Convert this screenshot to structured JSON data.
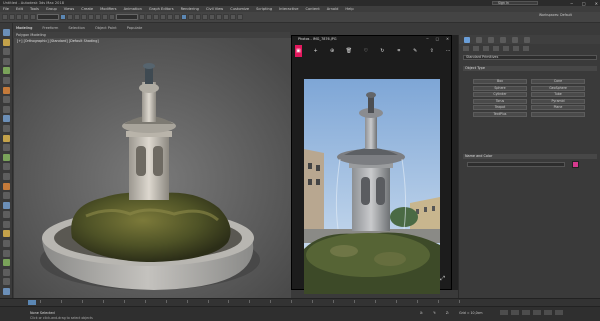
{
  "app": {
    "title": "Untitled - Autodesk 3ds Max 2018",
    "signin": "Sign In",
    "workspace": "Workspaces: Default",
    "window_controls": [
      "─",
      "□",
      "✕"
    ]
  },
  "menu": [
    "File",
    "Edit",
    "Tools",
    "Group",
    "Views",
    "Create",
    "Modifiers",
    "Animation",
    "Graph Editors",
    "Rendering",
    "Civil View",
    "Customize",
    "Scripting",
    "Interactive",
    "Content",
    "Arnold",
    "Help"
  ],
  "ribbon": {
    "tabs": [
      "Modeling",
      "Freeform",
      "Selection",
      "Object Paint",
      "Populate"
    ],
    "subtab": "Polygon Modeling"
  },
  "viewport": {
    "label": "[+] [Orthographic] [Standard] [Default Shading]"
  },
  "photos": {
    "title": "Photos - IMG_7876.JPG",
    "window_controls": [
      "─",
      "□",
      "✕"
    ],
    "toolbar": [
      "gallery",
      "add",
      "zoom",
      "delete",
      "favorite",
      "rotate",
      "crop",
      "edit",
      "share",
      "print",
      "more"
    ],
    "accent": "#e3185d"
  },
  "command_panel": {
    "dropdown": "Standard Primitives",
    "object_type_header": "Object Type",
    "objects": [
      "Box",
      "Cone",
      "Sphere",
      "GeoSphere",
      "Cylinder",
      "Tube",
      "Torus",
      "Pyramid",
      "Teapot",
      "Plane",
      "TextPlus",
      ""
    ],
    "name_color_header": "Name and Color",
    "swatch_color": "#d63a8e"
  },
  "status": {
    "line1": "None Selected",
    "line2": "Click or click-and-drag to select objects",
    "coords": [
      "X:",
      "Y:",
      "Z:",
      "Grid = 10,0cm"
    ],
    "frame": "0 / 100"
  }
}
